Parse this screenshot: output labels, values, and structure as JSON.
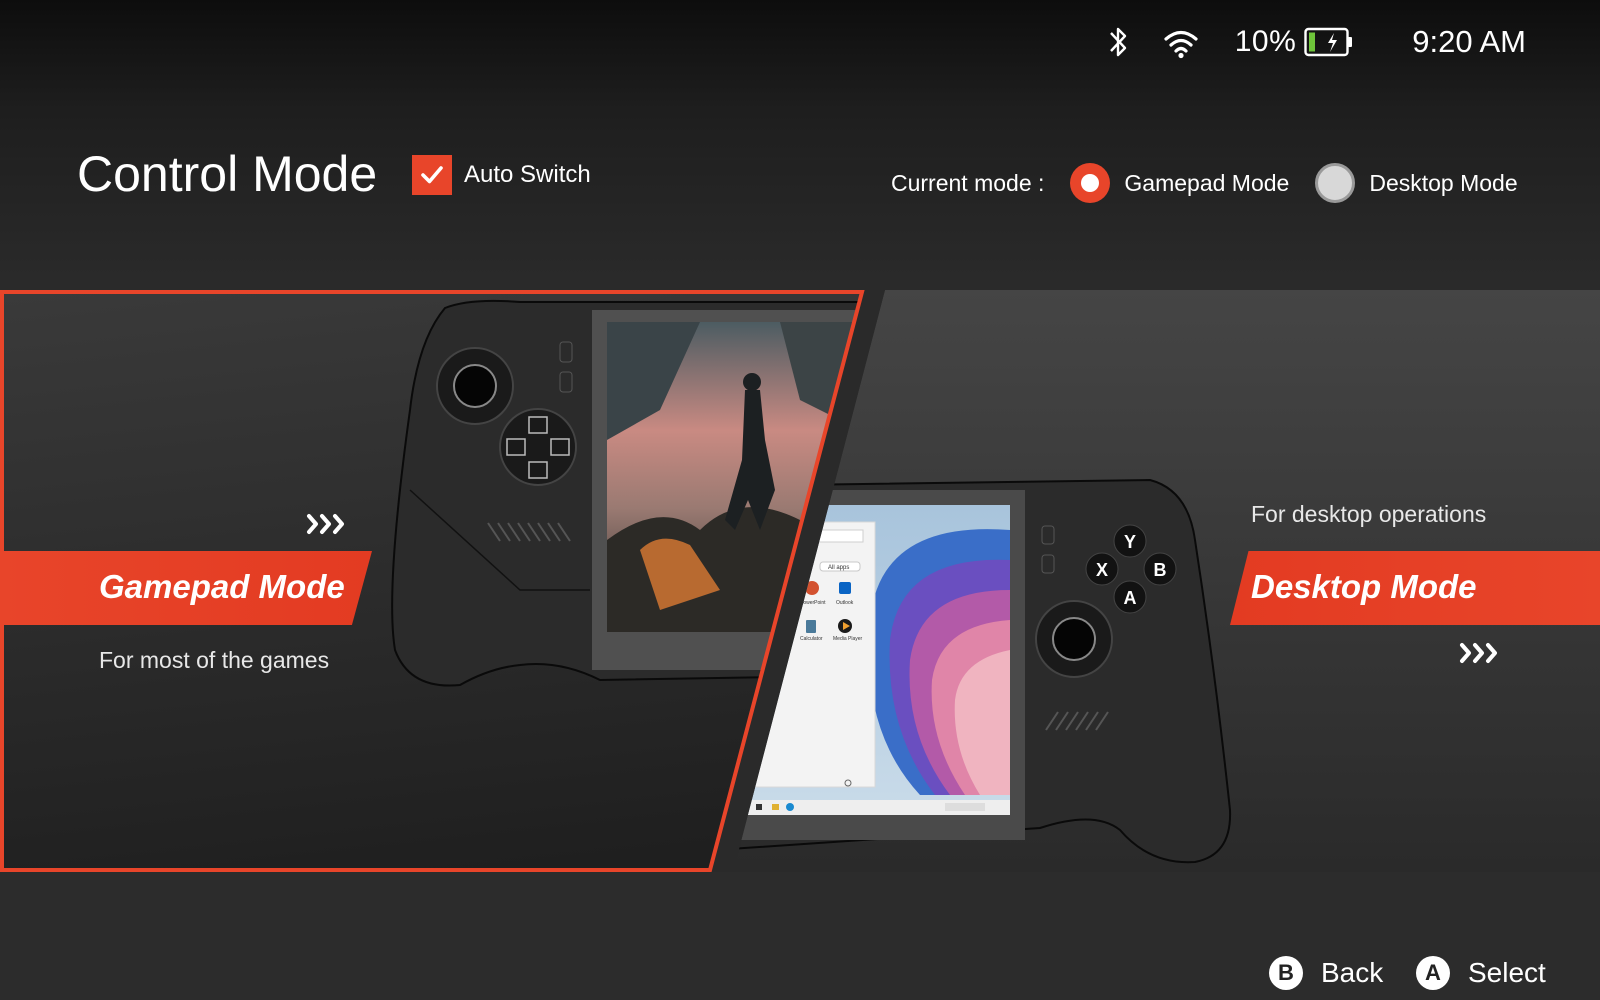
{
  "status_bar": {
    "bluetooth_icon": "bluetooth-icon",
    "wifi_icon": "wifi-icon",
    "battery_percent": "10%",
    "battery_level": 0.1,
    "battery_charging": true,
    "time": "9:20 AM"
  },
  "header": {
    "title": "Control Mode",
    "auto_switch": {
      "label": "Auto Switch",
      "checked": true
    },
    "current_mode": {
      "label": "Current mode :",
      "options": [
        {
          "label": "Gamepad Mode",
          "selected": true
        },
        {
          "label": "Desktop Mode",
          "selected": false
        }
      ]
    }
  },
  "modes": {
    "gamepad": {
      "title": "Gamepad Mode",
      "description": "For most of the games",
      "selected": true
    },
    "desktop": {
      "title": "Desktop Mode",
      "description": "For desktop operations",
      "selected": false
    }
  },
  "device_buttons": {
    "y": "Y",
    "x": "X",
    "b": "B",
    "a": "A"
  },
  "desktop_screen": {
    "start_menu_header": "All apps",
    "apps": [
      "PowerPoint",
      "Outlook",
      "Calculator",
      "Media Player"
    ]
  },
  "footer": {
    "back": {
      "button": "B",
      "label": "Back"
    },
    "select": {
      "button": "A",
      "label": "Select"
    }
  },
  "colors": {
    "accent": "#e8452a",
    "background": "#2c2c2c",
    "text": "#ffffff"
  }
}
